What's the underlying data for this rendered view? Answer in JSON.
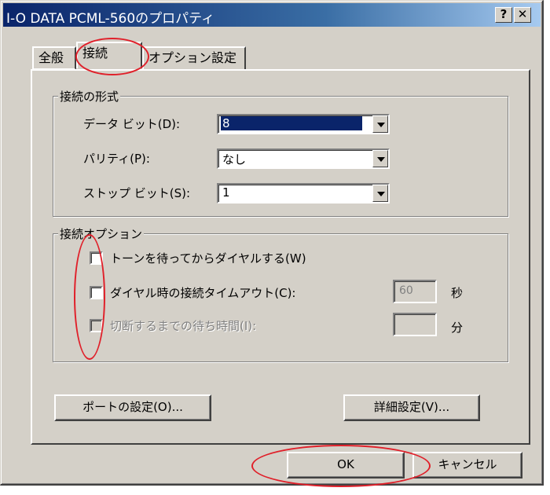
{
  "window": {
    "title": "I-O DATA PCML-560のプロパティ",
    "help_button": "?",
    "close_button": "✕"
  },
  "tabs": [
    {
      "label": "全般",
      "active": false
    },
    {
      "label": "接続",
      "active": true
    },
    {
      "label": "オプション設定",
      "active": false
    }
  ],
  "connection_format": {
    "group_label": "接続の形式",
    "data_bits": {
      "label": "データ ビット(D):",
      "value": "8"
    },
    "parity": {
      "label": "パリティ(P):",
      "value": "なし"
    },
    "stop_bits": {
      "label": "ストップ ビット(S):",
      "value": "1"
    }
  },
  "connection_options": {
    "group_label": "接続オプション",
    "wait_dialtone": {
      "label": "トーンを待ってからダイヤルする(W)",
      "checked": false
    },
    "dial_timeout": {
      "label": "ダイヤル時の接続タイムアウト(C):",
      "checked": false,
      "value": "60",
      "unit": "秒"
    },
    "disconnect_wait": {
      "label": "切断するまでの待ち時間(I):",
      "checked": false,
      "disabled": true,
      "value": "",
      "unit": "分"
    }
  },
  "buttons": {
    "port_settings": "ポートの設定(O)...",
    "advanced_settings": "詳細設定(V)...",
    "ok": "OK",
    "cancel": "キャンセル"
  },
  "colors": {
    "face": "#d4d0c8",
    "titlebar": "#0a246a",
    "annotation": "#e0202a"
  }
}
